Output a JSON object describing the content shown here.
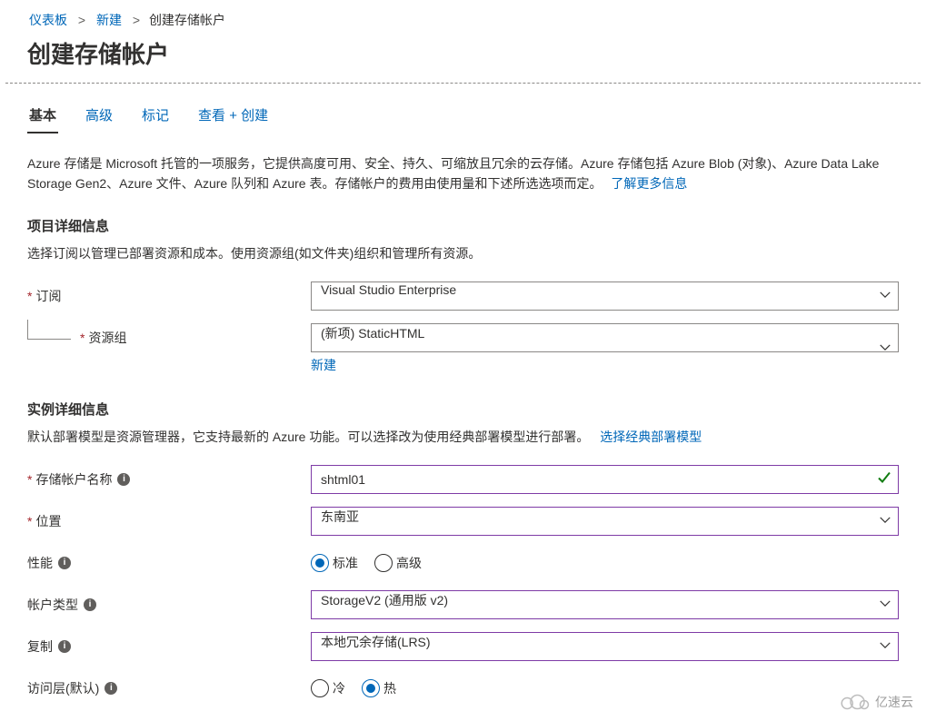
{
  "breadcrumb": {
    "dashboard": "仪表板",
    "new": "新建",
    "current": "创建存储帐户"
  },
  "page_title": "创建存储帐户",
  "tabs": {
    "basic": "基本",
    "advanced": "高级",
    "tags": "标记",
    "review": "查看 + 创建"
  },
  "intro": {
    "text": "Azure 存储是 Microsoft 托管的一项服务，它提供高度可用、安全、持久、可缩放且冗余的云存储。Azure 存储包括 Azure Blob (对象)、Azure Data Lake Storage Gen2、Azure 文件、Azure 队列和 Azure 表。存储帐户的费用由使用量和下述所选选项而定。",
    "link": "了解更多信息"
  },
  "project_details": {
    "title": "项目详细信息",
    "desc": "选择订阅以管理已部署资源和成本。使用资源组(如文件夹)组织和管理所有资源。",
    "subscription_label": "订阅",
    "subscription_value": "Visual Studio Enterprise",
    "resource_group_label": "资源组",
    "resource_group_value": "(新项) StaticHTML",
    "create_new_link": "新建"
  },
  "instance_details": {
    "title": "实例详细信息",
    "desc": "默认部署模型是资源管理器，它支持最新的 Azure 功能。可以选择改为使用经典部署模型进行部署。",
    "classic_link": "选择经典部署模型",
    "storage_name_label": "存储帐户名称",
    "storage_name_value": "shtml01",
    "location_label": "位置",
    "location_value": "东南亚",
    "performance_label": "性能",
    "performance_standard": "标准",
    "performance_premium": "高级",
    "account_kind_label": "帐户类型",
    "account_kind_value": "StorageV2 (通用版 v2)",
    "replication_label": "复制",
    "replication_value": "本地冗余存储(LRS)",
    "access_tier_label": "访问层(默认)",
    "access_tier_cool": "冷",
    "access_tier_hot": "热"
  },
  "watermark": "亿速云"
}
